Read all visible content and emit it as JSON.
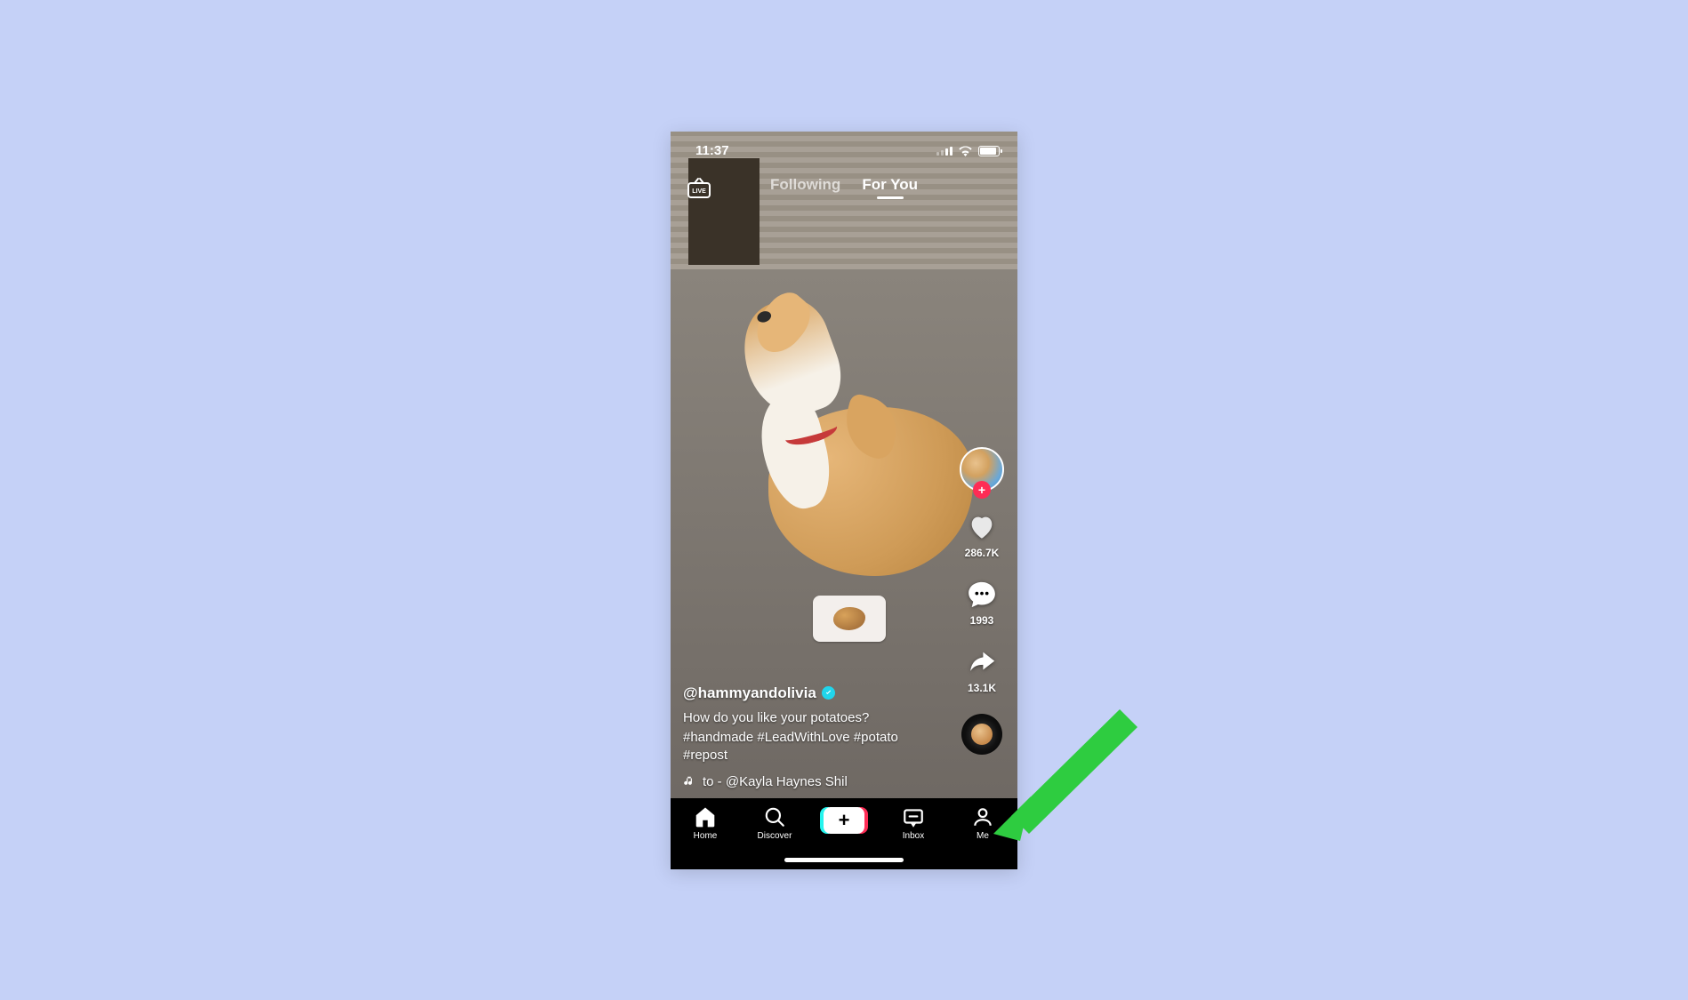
{
  "status": {
    "time": "11:37"
  },
  "topnav": {
    "live_label": "LIVE",
    "tabs": [
      {
        "label": "Following",
        "active": false
      },
      {
        "label": "For You",
        "active": true
      }
    ]
  },
  "actions": {
    "follow_plus": "+",
    "like_count": "286.7K",
    "comment_count": "1993",
    "share_count": "13.1K"
  },
  "meta": {
    "username": "@hammyandolivia",
    "caption": "How do you like your potatoes?",
    "hashtags_line1": "#handmade #LeadWithLove #potato",
    "hashtags_line2": "#repost",
    "sound": "to - @Kayla Haynes    Shil"
  },
  "tabbar": {
    "home": "Home",
    "discover": "Discover",
    "inbox": "Inbox",
    "me": "Me"
  }
}
